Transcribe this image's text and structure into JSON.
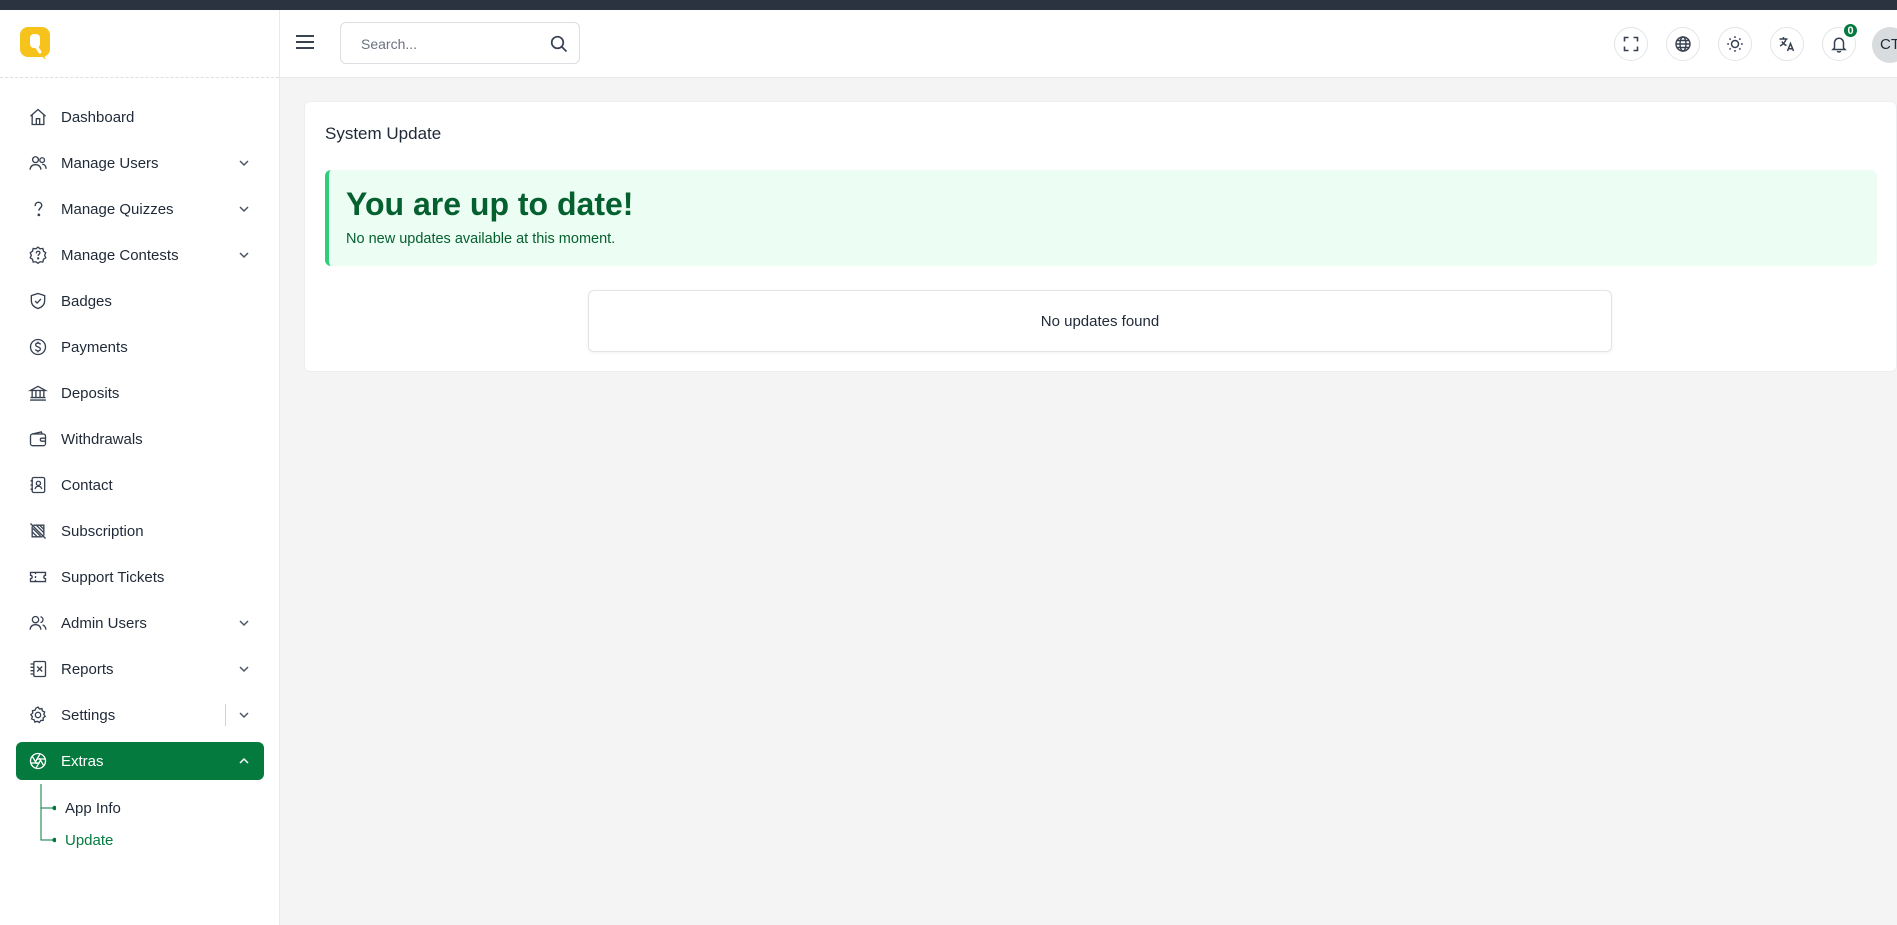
{
  "header": {
    "search_placeholder": "Search...",
    "notification_count": "0",
    "avatar_initials": "CT"
  },
  "sidebar": {
    "items": [
      {
        "label": "Dashboard",
        "icon": "home-icon",
        "has_children": false
      },
      {
        "label": "Manage Users",
        "icon": "users-icon",
        "has_children": true
      },
      {
        "label": "Manage Quizzes",
        "icon": "question-icon",
        "has_children": true
      },
      {
        "label": "Manage Contests",
        "icon": "question-circle-icon",
        "has_children": true
      },
      {
        "label": "Badges",
        "icon": "shield-check-icon",
        "has_children": false
      },
      {
        "label": "Payments",
        "icon": "dollar-circle-icon",
        "has_children": false
      },
      {
        "label": "Deposits",
        "icon": "bank-icon",
        "has_children": false
      },
      {
        "label": "Withdrawals",
        "icon": "wallet-icon",
        "has_children": false
      },
      {
        "label": "Contact",
        "icon": "contact-book-icon",
        "has_children": false
      },
      {
        "label": "Subscription",
        "icon": "subscription-icon",
        "has_children": false
      },
      {
        "label": "Support Tickets",
        "icon": "ticket-icon",
        "has_children": false
      },
      {
        "label": "Admin Users",
        "icon": "admin-users-icon",
        "has_children": true
      },
      {
        "label": "Reports",
        "icon": "report-icon",
        "has_children": true
      },
      {
        "label": "Settings",
        "icon": "gear-icon",
        "has_children": true
      },
      {
        "label": "Extras",
        "icon": "aperture-icon",
        "has_children": true,
        "active": true
      }
    ],
    "extras_children": [
      {
        "label": "App Info"
      },
      {
        "label": "Update",
        "current": true
      }
    ]
  },
  "main": {
    "card_title": "System Update",
    "alert_title": "You are up to date!",
    "alert_message": "No new updates available at this moment.",
    "empty_message": "No updates found"
  },
  "colors": {
    "accent": "#047a3f",
    "alert_bg": "#ecfdf3",
    "alert_border": "#2fcf7a",
    "logo": "#f6c21c"
  }
}
